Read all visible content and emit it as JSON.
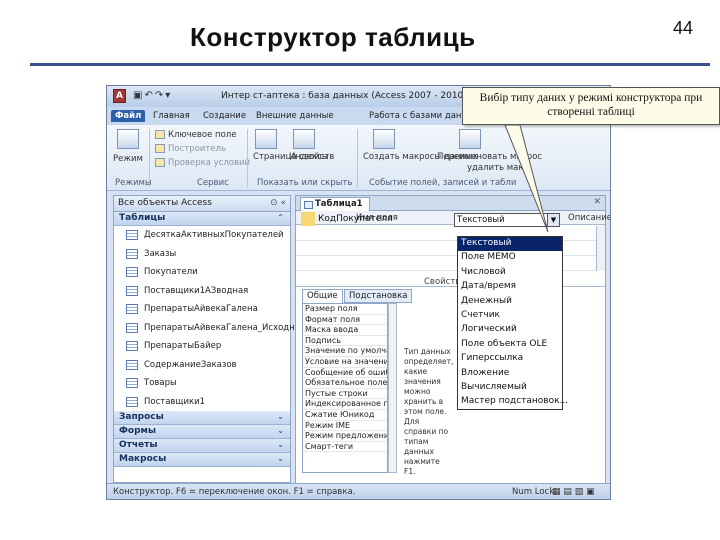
{
  "slide": {
    "title": "Конструктор таблиць",
    "page_number": "44",
    "callout_text": "Вибір типу даних у режимі конструктора при створенні таблиці"
  },
  "window": {
    "app_icon": "A",
    "title": "Интер  ст-аптека : база данных (Access 2007 - 2010)  Micr",
    "tabs": [
      "Файл",
      "Главная",
      "Создание",
      "Внешние данные",
      "Работа с базами данн"
    ],
    "ribbon": {
      "mode_button": "Режим",
      "key_field": "Ключевое поле",
      "builder": "Построитель",
      "check_conditions": "Проверка условий",
      "property_sheet": "Страница свойств",
      "indexes": "Индексы",
      "create_macros": "Создать макросы данных",
      "rename_macro": "Переименовать макрос",
      "delete_macro": "удалить макр",
      "groups": [
        "Режимы",
        "Сервис",
        "Показать или скрыть",
        "Событие полей, записей и табли"
      ]
    }
  },
  "nav_pane": {
    "header": "Все объекты Access",
    "groups": {
      "tables": "Таблицы",
      "queries": "Запросы",
      "forms": "Формы",
      "reports": "Отчеты",
      "macros": "Макросы"
    },
    "tables": [
      "ДесяткаАктивныхПокупателей",
      "Заказы",
      "Покупатели",
      "Поставщики1АЗводная",
      "ПрепаратыАйвекаГалена",
      "ПрепаратыАйвекаГалена_Исходная",
      "ПрепаратыБайер",
      "СодержаниеЗаказов",
      "Товары",
      "Поставщики1"
    ]
  },
  "design": {
    "tab_label": "Таблица1",
    "col_field_name": "Имя поля",
    "col_data_type": "Тип данных",
    "col_description": "Описание",
    "field_name_value": "КодПокупателя",
    "data_type_value": "Текстовый",
    "field_properties": "Свойства поля",
    "prop_tabs": [
      "Общие",
      "Подстановка"
    ],
    "properties": [
      "Размер поля",
      "Формат поля",
      "Маска ввода",
      "Подпись",
      "Значение по умолчанию",
      "Условие на значение",
      "Сообщение об ошибке",
      "Обязательное поле",
      "Пустые строки",
      "Индексированное поле",
      "Сжатие Юникод",
      "Режим IME",
      "Режим предложений IME",
      "Смарт-теги"
    ],
    "help_text": "Тип данных определяет, какие значения можно хранить в этом поле. Для справки по типам данных нажмите F1."
  },
  "dropdown": {
    "options": [
      "Текстовый",
      "Поле MEMO",
      "Числовой",
      "Дата/время",
      "Денежный",
      "Счетчик",
      "Логический",
      "Поле объекта OLE",
      "Гиперссылка",
      "Вложение",
      "Вычисляемый",
      "Мастер подстановок..."
    ],
    "highlighted_index": 0
  },
  "status_bar": {
    "left": "Конструктор. F6 = переключение окон. F1 = справка.",
    "num_lock": "Num Lock"
  }
}
